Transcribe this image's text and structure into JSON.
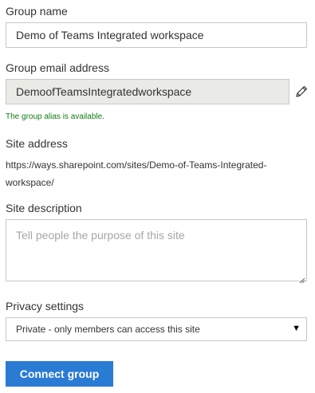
{
  "group_name": {
    "label": "Group name",
    "value": "Demo of Teams Integrated workspace"
  },
  "group_email": {
    "label": "Group email address",
    "value": "DemoofTeamsIntegratedworkspace",
    "status": "The group alias is available.",
    "edit_icon": "pencil-icon"
  },
  "site_address": {
    "label": "Site address",
    "url_line1": "https://ways.sharepoint.com/sites/Demo-of-Teams-Integrated-",
    "url_line2": "workspace/"
  },
  "site_description": {
    "label": "Site description",
    "placeholder": "Tell people the purpose of this site"
  },
  "privacy": {
    "label": "Privacy settings",
    "selected": "Private - only members can access this site",
    "caret_icon": "triangle-down-icon"
  },
  "connect_button": {
    "label": "Connect group"
  },
  "colors": {
    "accent": "#2a7bd4",
    "success": "#107c10",
    "disabled_bg": "#eaeae6"
  }
}
